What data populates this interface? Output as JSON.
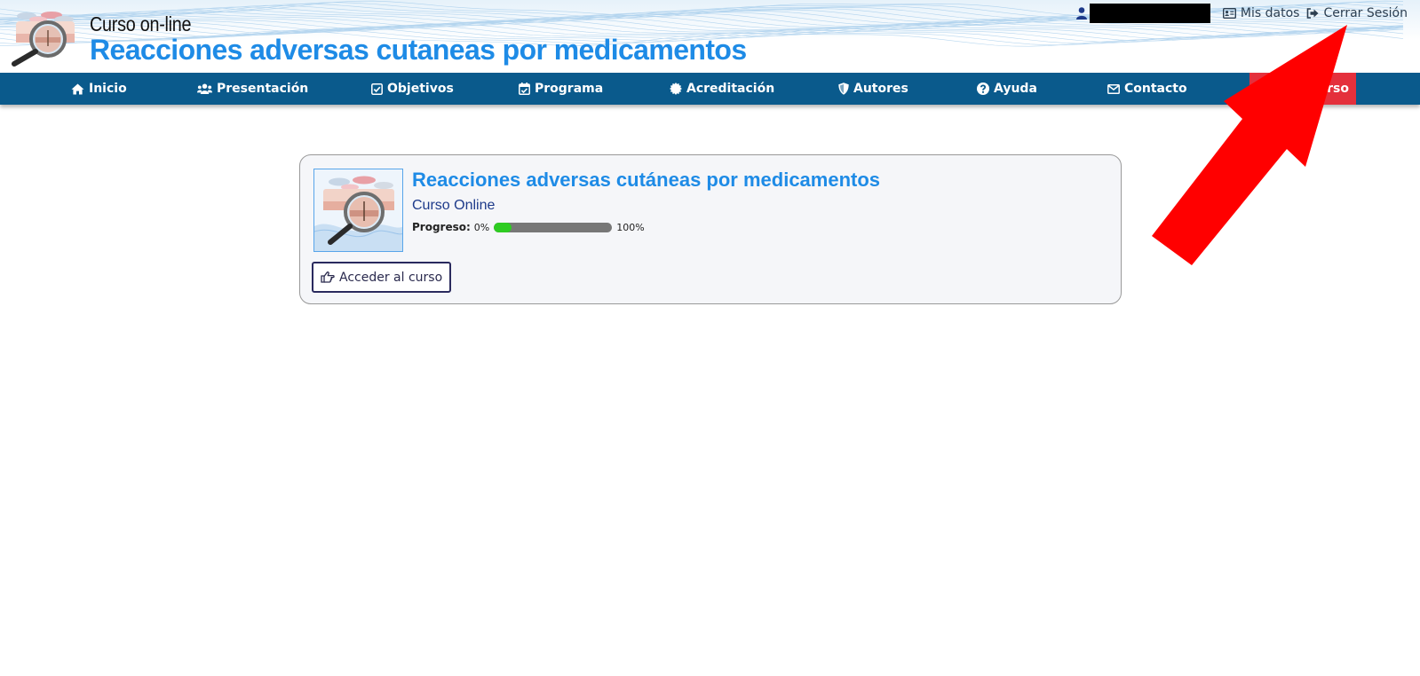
{
  "header": {
    "subtitle": "Curso on-line",
    "title": "Reacciones adversas cutaneas por medicamentos",
    "logo_icon": "magnifier-skin-logo"
  },
  "userbar": {
    "user_icon": "user-icon",
    "username": "",
    "links": [
      {
        "label": "Mis datos",
        "icon": "id-card-icon"
      },
      {
        "label": "Cerrar Sesión",
        "icon": "sign-out-icon"
      }
    ]
  },
  "nav": {
    "items": [
      {
        "label": "Inicio",
        "icon": "home-icon"
      },
      {
        "label": "Presentación",
        "icon": "users-icon"
      },
      {
        "label": "Objetivos",
        "icon": "check-square-icon"
      },
      {
        "label": "Programa",
        "icon": "calendar-check-icon"
      },
      {
        "label": "Acreditación",
        "icon": "certificate-icon"
      },
      {
        "label": "Autores",
        "icon": "shield-icon"
      },
      {
        "label": "Ayuda",
        "icon": "question-circle-icon"
      },
      {
        "label": "Contacto",
        "icon": "envelope-icon"
      },
      {
        "label": "urso",
        "icon": "",
        "partially_hidden": true
      }
    ],
    "bar_color": "#0a5a8c",
    "highlight_color": "#e4303c"
  },
  "course": {
    "title": "Reacciones adversas cutáneas por medicamentos",
    "subtitle": "Curso Online",
    "progress_label": "Progreso:",
    "progress_min": "0%",
    "progress_max": "100%",
    "progress_fraction": 0.15,
    "button_label": "Acceder al curso",
    "button_icon": "hand-point-right-icon"
  },
  "colors": {
    "accent_blue": "#1e8be6",
    "annotation_arrow": "#ff0000",
    "progress_fill": "#2ecc22"
  }
}
